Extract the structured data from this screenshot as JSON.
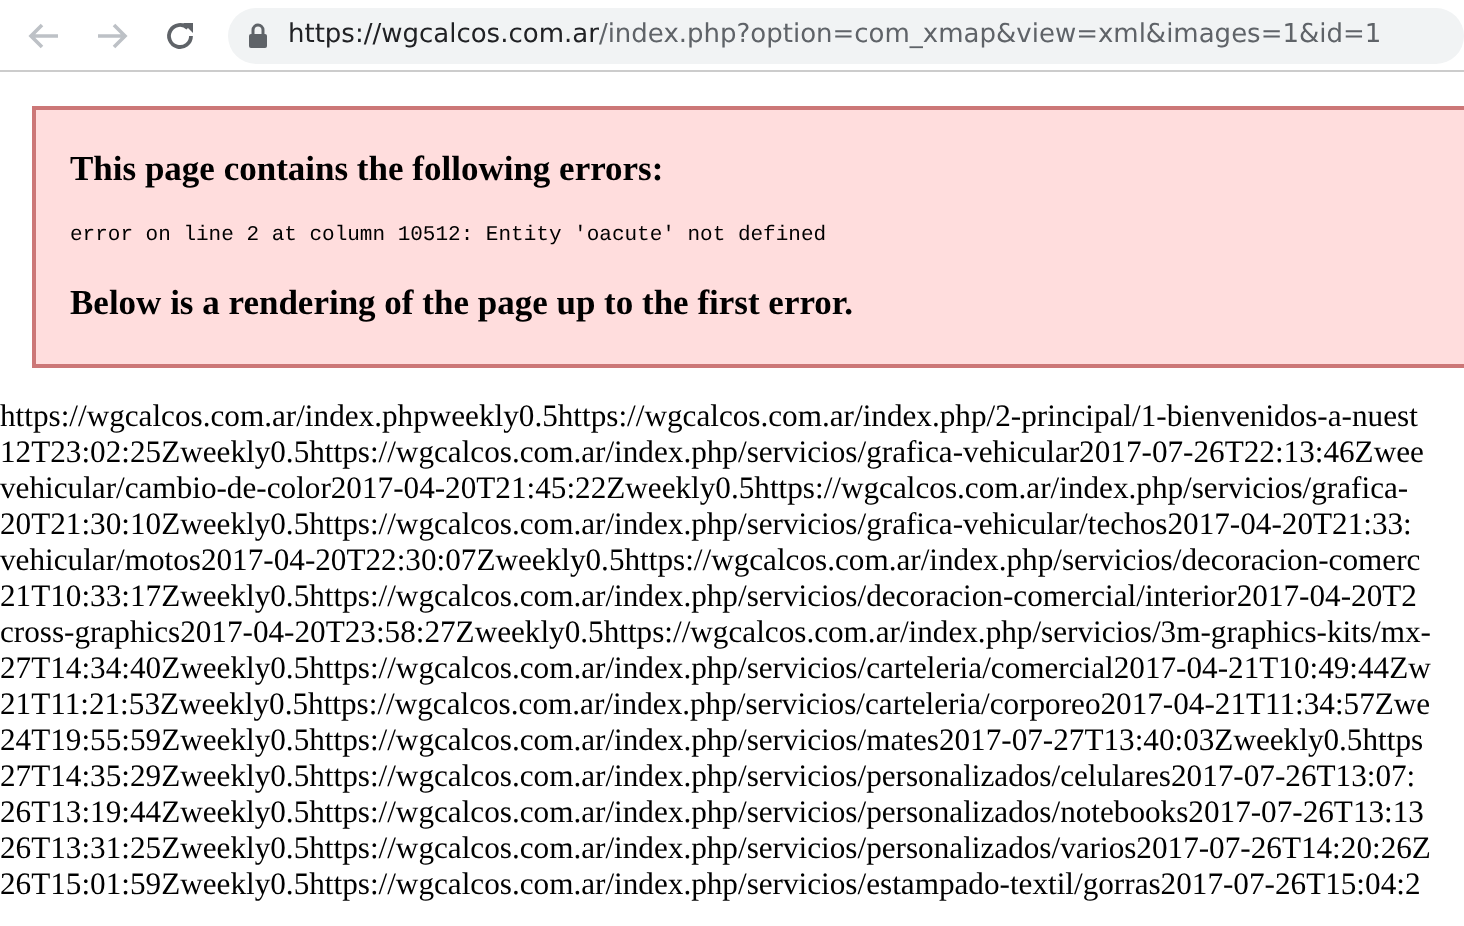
{
  "browser": {
    "url_host": "https://wgcalcos.com.ar",
    "url_path": "/index.php?option=com_xmap&view=xml&images=1&id=1",
    "back_enabled": false,
    "forward_enabled": false,
    "secure": true
  },
  "error_box": {
    "title": "This page contains the following errors:",
    "message": "error on line 2 at column 10512: Entity 'oacute' not defined",
    "footer": "Below is a rendering of the page up to the first error."
  },
  "content_lines": [
    "https://wgcalcos.com.ar/index.phpweekly0.5https://wgcalcos.com.ar/index.php/2-principal/1-bienvenidos-a-nuest",
    "12T23:02:25Zweekly0.5https://wgcalcos.com.ar/index.php/servicios/grafica-vehicular2017-07-26T22:13:46Zwee",
    "vehicular/cambio-de-color2017-04-20T21:45:22Zweekly0.5https://wgcalcos.com.ar/index.php/servicios/grafica-",
    "20T21:30:10Zweekly0.5https://wgcalcos.com.ar/index.php/servicios/grafica-vehicular/techos2017-04-20T21:33:",
    "vehicular/motos2017-04-20T22:30:07Zweekly0.5https://wgcalcos.com.ar/index.php/servicios/decoracion-comerc",
    "21T10:33:17Zweekly0.5https://wgcalcos.com.ar/index.php/servicios/decoracion-comercial/interior2017-04-20T2",
    "cross-graphics2017-04-20T23:58:27Zweekly0.5https://wgcalcos.com.ar/index.php/servicios/3m-graphics-kits/mx-",
    "27T14:34:40Zweekly0.5https://wgcalcos.com.ar/index.php/servicios/carteleria/comercial2017-04-21T10:49:44Zw",
    "21T11:21:53Zweekly0.5https://wgcalcos.com.ar/index.php/servicios/carteleria/corporeo2017-04-21T11:34:57Zwe",
    "24T19:55:59Zweekly0.5https://wgcalcos.com.ar/index.php/servicios/mates2017-07-27T13:40:03Zweekly0.5https",
    "27T14:35:29Zweekly0.5https://wgcalcos.com.ar/index.php/servicios/personalizados/celulares2017-07-26T13:07:",
    "26T13:19:44Zweekly0.5https://wgcalcos.com.ar/index.php/servicios/personalizados/notebooks2017-07-26T13:13",
    "26T13:31:25Zweekly0.5https://wgcalcos.com.ar/index.php/servicios/personalizados/varios2017-07-26T14:20:26Z",
    "26T15:01:59Zweekly0.5https://wgcalcos.com.ar/index.php/servicios/estampado-textil/gorras2017-07-26T15:04:2"
  ]
}
